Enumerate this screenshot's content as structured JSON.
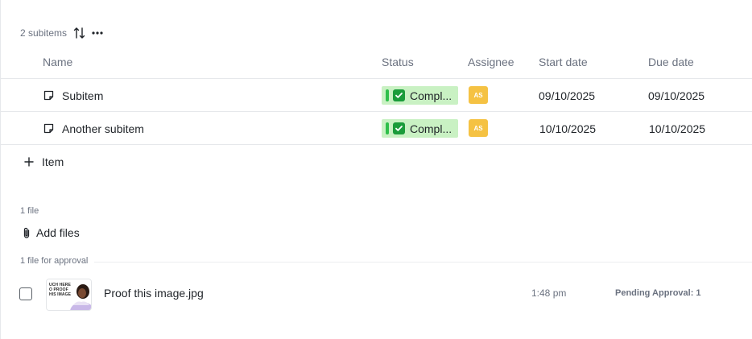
{
  "subitems": {
    "count_label": "2 subitems",
    "columns": {
      "name": "Name",
      "status": "Status",
      "assignee": "Assignee",
      "start_date": "Start date",
      "due_date": "Due date"
    },
    "rows": [
      {
        "name": "Subitem",
        "status": "Compl...",
        "assignee_initials": "AS",
        "start_date": "09/10/2025",
        "due_date": "09/10/2025"
      },
      {
        "name": "Another subitem",
        "status": "Compl...",
        "assignee_initials": "AS",
        "start_date": "10/10/2025",
        "due_date": "10/10/2025"
      }
    ],
    "add_item_label": "Item",
    "status_color": "#c9f1c3",
    "assignee_color": "#f5c243"
  },
  "files": {
    "count_label": "1 file",
    "add_files_label": "Add files",
    "approval_section_label": "1 file for approval",
    "items": [
      {
        "name": "Proof this image.jpg",
        "time": "1:48 pm",
        "approval_status": "Pending Approval: 1",
        "thumbnail_text": [
          "UCH HERE",
          "O PROOF",
          "HIS IMAGE"
        ]
      }
    ]
  }
}
